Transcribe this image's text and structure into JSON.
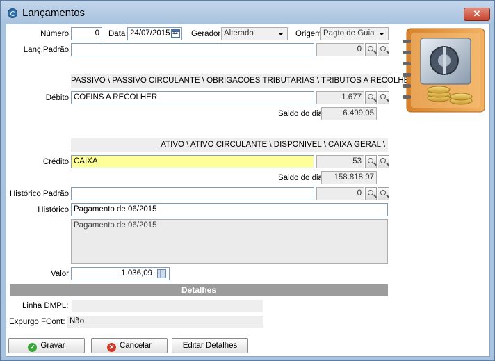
{
  "window": {
    "title": "Lançamentos",
    "close_label": "✕"
  },
  "form": {
    "numero": {
      "label": "Número",
      "value": "0"
    },
    "data": {
      "label": "Data",
      "value": "24/07/2015",
      "calendar_day": "12"
    },
    "gerador": {
      "label": "Gerador",
      "value": "Alterado"
    },
    "origem": {
      "label": "Origem",
      "value": "Pagto de Guia"
    },
    "lanc_padrao": {
      "label": "Lanç.Padrão",
      "value": "",
      "code": "0"
    },
    "debito": {
      "path": "PASSIVO \\ PASSIVO CIRCULANTE \\ OBRIGACOES TRIBUTARIAS \\ TRIBUTOS A RECOLHER \\",
      "label": "Débito",
      "value": "COFINS A RECOLHER",
      "code": "1.677",
      "saldo_label": "Saldo do dia",
      "saldo_value": "6.499,05"
    },
    "credito": {
      "path": "ATIVO \\ ATIVO CIRCULANTE \\ DISPONIVEL \\ CAIXA GERAL \\",
      "label": "Crédito",
      "value": "CAIXA",
      "code": "53",
      "saldo_label": "Saldo do dia",
      "saldo_value": "158.818,97"
    },
    "historico_padrao": {
      "label": "Histórico Padrão",
      "value": "",
      "code": "0"
    },
    "historico": {
      "label": "Histórico",
      "value": "Pagamento de 06/2015",
      "memo": "Pagamento de 06/2015"
    },
    "valor": {
      "label": "Valor",
      "value": "1.036,09"
    }
  },
  "detalhes": {
    "title": "Detalhes",
    "linha_dmpl": {
      "label": "Linha DMPL:",
      "value": ""
    },
    "expurgo_fcont": {
      "label": "Expurgo FCont:",
      "value": "Não"
    }
  },
  "buttons": {
    "gravar": "Gravar",
    "cancelar": "Cancelar",
    "editar_detalhes": "Editar Detalhes"
  },
  "icons": {
    "title": "app-icon",
    "search": "search-icon",
    "calendar": "calendar-icon",
    "calculator": "calculator-icon",
    "ok": "check-icon",
    "cancel": "cancel-icon",
    "illustration": "safe-coins-icon"
  },
  "colors": {
    "titlebar": "#a9c3de",
    "highlight_field": "#ffff99",
    "section_bar": "#9c9c9c"
  }
}
